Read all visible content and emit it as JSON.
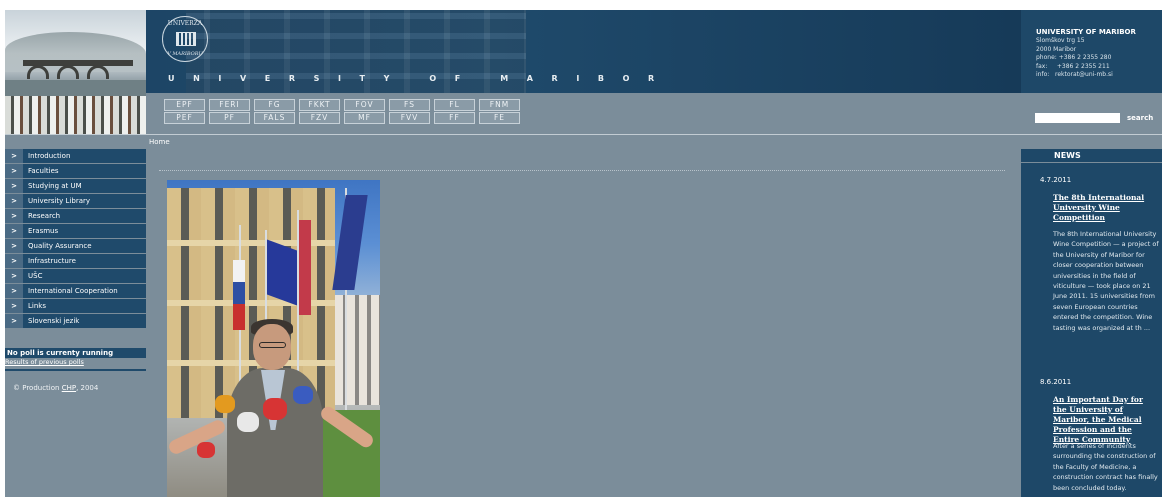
{
  "faculties": {
    "row1": [
      "EPF",
      "FERI",
      "FG",
      "FKKT",
      "FOV",
      "FS",
      "FL",
      "FNM"
    ],
    "row2": [
      "PEF",
      "PF",
      "FALS",
      "FZV",
      "MF",
      "FVV",
      "FF",
      "FE"
    ]
  },
  "branding": {
    "uni_wordmark": "UNIVERSITY OF MARIBOR",
    "seal_top": "UNIVERZA",
    "seal_bottom": "V MARIBORU"
  },
  "contact": {
    "title": "UNIVERSITY OF MARIBOR",
    "address1": "Slomškov trg 15",
    "address2": "2000 Maribor",
    "phone": "phone: +386 2 2355 280",
    "fax": "fax:     +386 2 2355 211",
    "info": "info:   rektorat@uni-mb.si"
  },
  "search": {
    "placeholder": "",
    "button_label": "search"
  },
  "breadcrumb": "Home",
  "sidebar": {
    "arrow": ">",
    "items": [
      "Introduction",
      "Faculties",
      "Studying at UM",
      "University Library",
      "Research",
      "Erasmus",
      "Quality Assurance",
      "Infrastructure",
      "UŠC",
      "International Cooperation",
      "Links",
      "Slovenski jezik"
    ]
  },
  "poll": {
    "title": "No poll is currenty running",
    "link": "Results of previous polls"
  },
  "footer": {
    "prefix": "© Production",
    "link": "CHP",
    "suffix": ", 2004"
  },
  "news": {
    "header": "NEWS",
    "items": [
      {
        "date": "4.7.2011",
        "title": "The 8th International University Wine Competition",
        "body": "The 8th International University Wine Competition — a project of the University of Maribor for closer cooperation between universities in the field of viticulture — took place on 21 June 2011. 15 universities from seven European countries entered the competition. Wine tasting was organized at th ..."
      },
      {
        "date": "8.6.2011",
        "title": "An Important Day for the University of Maribor, the Medical Profession and the Entire Community",
        "body": "After a series of incidents surrounding the construction of the Faculty of Medicine, a construction contract has finally been concluded today."
      }
    ]
  },
  "colors": {
    "page_bg": "#7b8d9a",
    "navy": "#1e4868",
    "menu_arrow": "#4a6a84"
  }
}
